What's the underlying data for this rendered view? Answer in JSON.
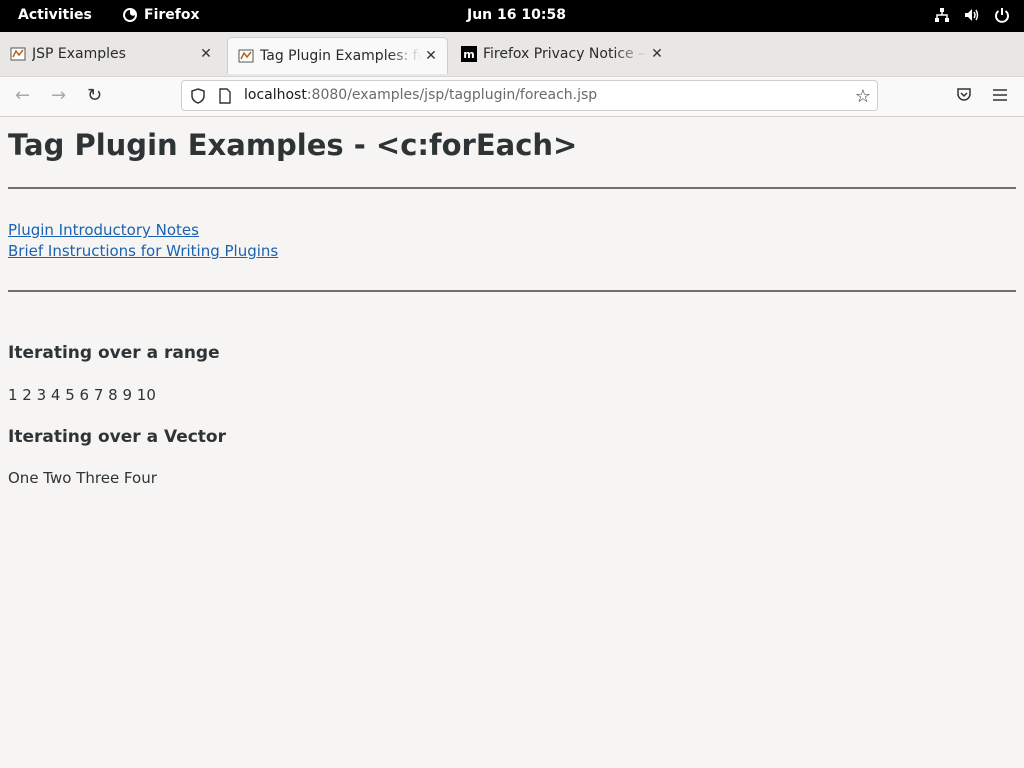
{
  "system": {
    "activities": "Activities",
    "app_name": "Firefox",
    "clock": "Jun 16  10:58"
  },
  "tabs": [
    {
      "title": "JSP Examples",
      "active": false
    },
    {
      "title": "Tag Plugin Examples: forE",
      "active": true
    },
    {
      "title": "Firefox Privacy Notice — M",
      "active": false
    }
  ],
  "urlbar": {
    "host": "localhost",
    "path": ":8080/examples/jsp/tagplugin/foreach.jsp"
  },
  "page": {
    "heading": "Tag Plugin Examples - <c:forEach>",
    "links": [
      "Plugin Introductory Notes",
      "Brief Instructions for Writing Plugins"
    ],
    "section1_heading": "Iterating over a range",
    "section1_text": "1 2 3 4 5 6 7 8 9 10",
    "section2_heading": "Iterating over a Vector",
    "section2_text": "One Two Three Four"
  },
  "colors": {
    "link": "#1c62b0",
    "text": "#2e3436",
    "background": "#f6f5f4"
  }
}
